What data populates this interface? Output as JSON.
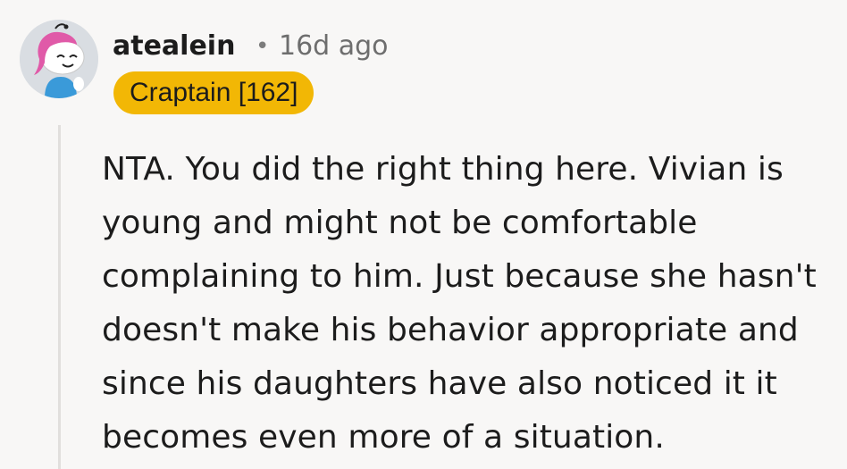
{
  "comment": {
    "author": "atealein",
    "separator": "•",
    "timestamp": "16d ago",
    "flair": "Craptain [162]",
    "flair_color": "#f2b705",
    "avatar_icon": "snoo-avatar-icon",
    "body": "NTA. You did the right thing here. Vivian is young and might not be comfortable complaining to him. Just because she hasn't doesn't make his behavior appropriate and since his daughters have also noticed it it becomes even more of a situation."
  }
}
